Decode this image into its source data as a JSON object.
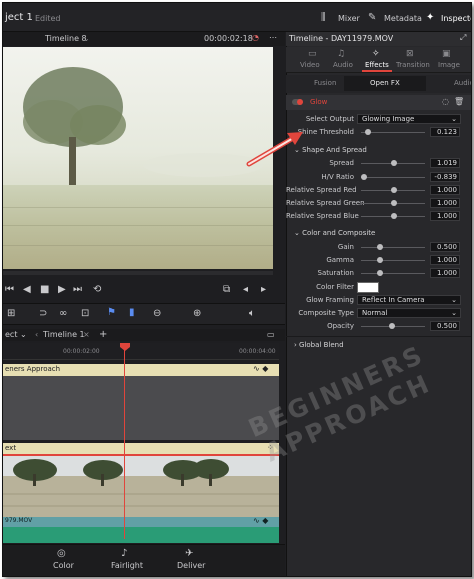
{
  "topbar": {
    "project": "ject 1",
    "status": "Edited",
    "mixer": "Mixer",
    "metadata": "Metadata",
    "inspector": "Inspector"
  },
  "viewer": {
    "timeline": "Timeline 8",
    "timecode": "00:00:02:18"
  },
  "timeline": {
    "tab_label": "Timeline 1",
    "ruler_tc1": "00:00:02:00",
    "ruler_tc2": "00:00:04:00",
    "track1_label": "eners Approach",
    "track2_label": "ext",
    "audio_label": "979.MOV"
  },
  "bottom": {
    "color": "Color",
    "fairlight": "Fairlight",
    "deliver": "Deliver"
  },
  "inspector": {
    "title": "Timeline - DAY11979.MOV",
    "tabs": [
      "Video",
      "Audio",
      "Effects",
      "Transition",
      "Image"
    ],
    "subtabs": [
      "Fusion",
      "Open FX",
      "Audio"
    ],
    "effect_name": "Glow",
    "select_output_label": "Select Output",
    "select_output_value": "Glowing Image",
    "shine_label": "Shine Threshold",
    "shine_value": "0.123",
    "shape_section": "Shape And Spread",
    "spread_label": "Spread",
    "spread_value": "1.019",
    "hv_label": "H/V Ratio",
    "hv_value": "-0.839",
    "rsr_label": "Relative Spread Red",
    "rsr_value": "1.000",
    "rsg_label": "Relative Spread Green",
    "rsg_value": "1.000",
    "rsb_label": "Relative Spread Blue",
    "rsb_value": "1.000",
    "color_section": "Color and Composite",
    "gain_label": "Gain",
    "gain_value": "0.500",
    "gamma_label": "Gamma",
    "gamma_value": "1.000",
    "sat_label": "Saturation",
    "sat_value": "1.000",
    "cf_label": "Color Filter",
    "gf_label": "Glow Framing",
    "gf_value": "Reflect In Camera",
    "ct_label": "Composite Type",
    "ct_value": "Normal",
    "op_label": "Opacity",
    "op_value": "0.500",
    "global_section": "Global Blend"
  },
  "watermark": {
    "line1": "BEGINNERS",
    "line2": "APPROACH"
  },
  "colors": {
    "accent_red": "#e0453c",
    "panel": "#28282b",
    "track_yellow": "#e7dfb3",
    "audio_teal": "#61a0a6",
    "green_bar": "#2a9c76"
  }
}
